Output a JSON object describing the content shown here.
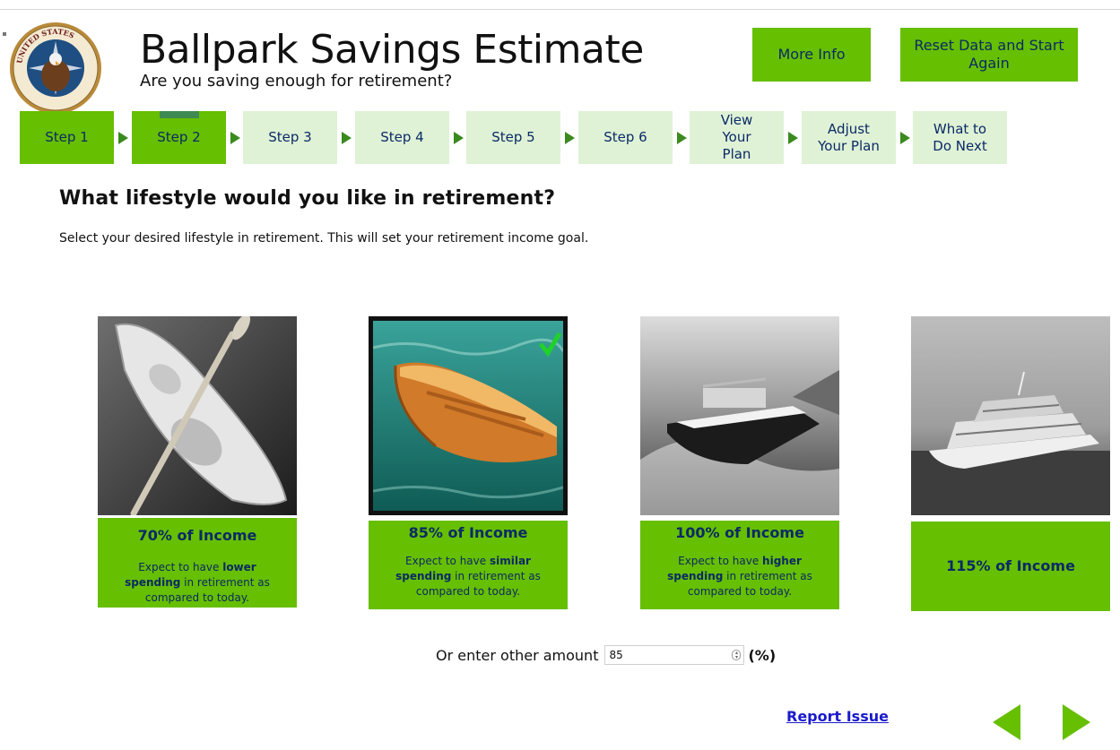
{
  "header": {
    "title": "Ballpark Savings Estimate",
    "subtitle": "Are you saving enough for retirement?",
    "more_info": "More Info",
    "reset": "Reset Data and Start Again",
    "seal_text": "UNITED STATES OFFICE OF PERSONNEL MANAGEMENT"
  },
  "steps": [
    {
      "label": "Step 1",
      "state": "done"
    },
    {
      "label": "Step 2",
      "state": "current"
    },
    {
      "label": "Step 3",
      "state": "todo"
    },
    {
      "label": "Step 4",
      "state": "todo"
    },
    {
      "label": "Step 5",
      "state": "todo"
    },
    {
      "label": "Step 6",
      "state": "todo"
    },
    {
      "label": "View Your Plan",
      "state": "todo"
    },
    {
      "label": "Adjust Your Plan",
      "state": "todo"
    },
    {
      "label": "What to Do Next",
      "state": "todo"
    }
  ],
  "main": {
    "question": "What lifestyle would you like in retirement?",
    "instruction": "Select your desired lifestyle in retirement. This will set your retirement income goal."
  },
  "options": [
    {
      "pct": "70% of Income",
      "desc_pre": "Expect to have ",
      "desc_bold": "lower spending",
      "desc_post": " in retirement as compared to today.",
      "selected": false
    },
    {
      "pct": "85% of Income",
      "desc_pre": "Expect to have ",
      "desc_bold": "similar spending",
      "desc_post": " in retirement as compared to today.",
      "selected": true
    },
    {
      "pct": "100% of Income",
      "desc_pre": "Expect to have ",
      "desc_bold": "higher spending",
      "desc_post": " in retirement as compared to today.",
      "selected": false
    },
    {
      "pct": "115% of Income",
      "desc_pre": "",
      "desc_bold": "",
      "desc_post": "",
      "selected": false
    }
  ],
  "other": {
    "label": "Or enter other amount",
    "value": "85",
    "unit": "(%)"
  },
  "footer": {
    "report": "Report Issue"
  },
  "colors": {
    "accent_green": "#66bf00",
    "light_green": "#dff2d6",
    "text_navy": "#0b2a66"
  }
}
